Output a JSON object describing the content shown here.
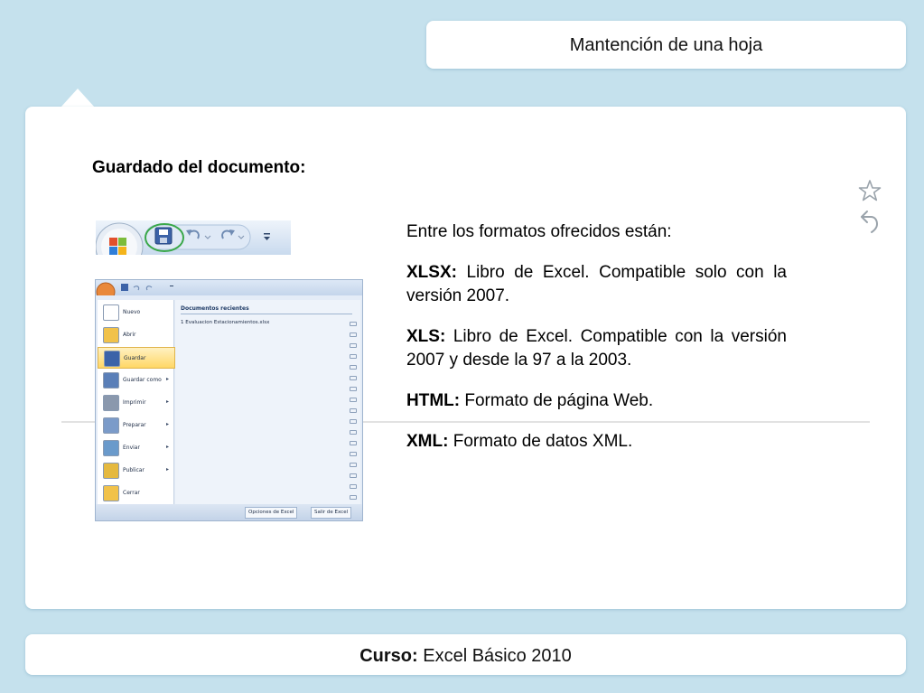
{
  "header": {
    "title": "Mantención de una hoja"
  },
  "content": {
    "heading": "Guardado del documento:",
    "intro": "Entre los formatos ofrecidos están:",
    "formats": [
      {
        "name": "XLSX:",
        "description": " Libro de Excel. Compatible solo con la versión 2007."
      },
      {
        "name": "XLS:",
        "description": " Libro de Excel. Compatible con la versión 2007 y desde la 97 a la 2003."
      },
      {
        "name": "HTML:",
        "description": " Formato de página Web."
      },
      {
        "name": "XML:",
        "description": " Formato de datos XML."
      }
    ]
  },
  "office_menu": {
    "items": [
      {
        "label": "Nuevo",
        "has_submenu": false
      },
      {
        "label": "Abrir",
        "has_submenu": false
      },
      {
        "label": "Guardar",
        "has_submenu": false,
        "active": true
      },
      {
        "label": "Guardar como",
        "has_submenu": true
      },
      {
        "label": "Imprimir",
        "has_submenu": true
      },
      {
        "label": "Preparar",
        "has_submenu": true
      },
      {
        "label": "Enviar",
        "has_submenu": true
      },
      {
        "label": "Publicar",
        "has_submenu": true
      },
      {
        "label": "Cerrar",
        "has_submenu": false
      }
    ],
    "recent_title": "Documentos recientes",
    "recent_files": [
      "1  Evaluacion Estacionamientos.xlsx"
    ],
    "options_button": "Opciones de Excel",
    "exit_button": "Salir de Excel"
  },
  "footer": {
    "label": "Curso:",
    "value": " Excel Básico 2010"
  },
  "icons": {
    "favorite": "star-icon",
    "back": "back-arrow-icon",
    "save": "save-icon",
    "undo": "undo-icon",
    "redo": "redo-icon",
    "office": "office-button-icon"
  },
  "colors": {
    "background": "#c5e1ed",
    "panel": "#ffffff",
    "highlight_circle": "#3aa84a",
    "active_menu": "#ffd766"
  }
}
